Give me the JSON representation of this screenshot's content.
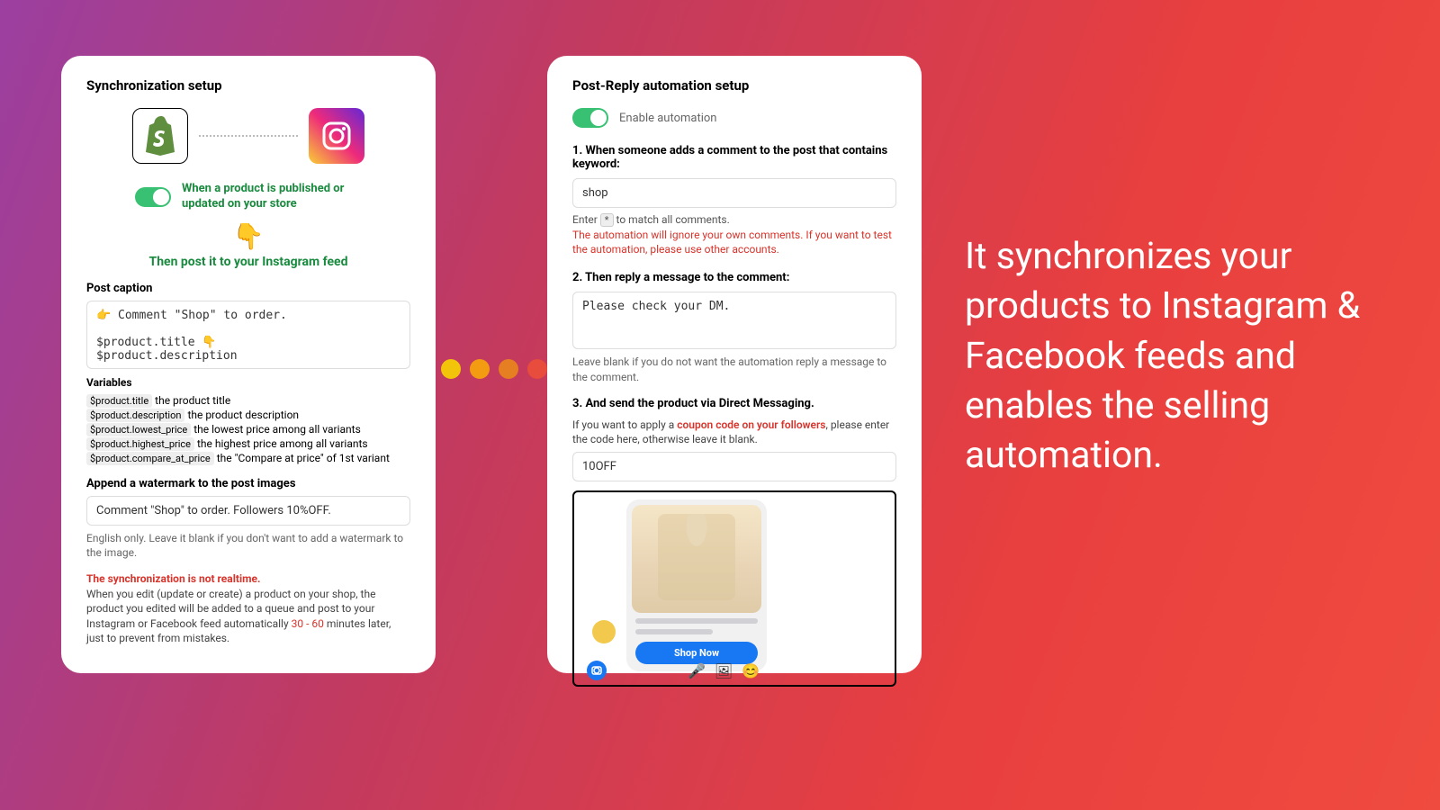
{
  "headline": "It synchronizes your products to Instagram & Facebook feeds and enables the selling automation.",
  "left": {
    "title": "Synchronization setup",
    "sync_toggle": "When a product is published or updated on your store",
    "then_post": "Then post it to your Instagram feed",
    "caption_label": "Post caption",
    "caption_value": "👉 Comment \"Shop\" to order.\n\n$product.title 👇\n$product.description",
    "variables_label": "Variables",
    "vars": [
      {
        "code": "$product.title",
        "desc": "the product title"
      },
      {
        "code": "$product.description",
        "desc": "the product description"
      },
      {
        "code": "$product.lowest_price",
        "desc": "the lowest price among all variants"
      },
      {
        "code": "$product.highest_price",
        "desc": "the highest price among all variants"
      },
      {
        "code": "$product.compare_at_price",
        "desc": "the \"Compare at price\" of 1st variant"
      }
    ],
    "watermark_label": "Append a watermark to the post images",
    "watermark_value": "Comment \"Shop\" to order. Followers 10%OFF.",
    "watermark_help": "English only. Leave it blank if you don't want to add a watermark to the image.",
    "warn_title": "The synchronization is not realtime.",
    "warn_body_pre": "When you edit (update or create) a product on your shop, the product you edited will be added to a queue and post to your Instagram or Facebook feed automatically ",
    "warn_body_red": "30 - 60",
    "warn_body_post": " minutes later, just to prevent from mistakes."
  },
  "right": {
    "title": "Post-Reply automation setup",
    "enable_label": "Enable automation",
    "step1": "1. When someone adds a comment to the post that contains keyword:",
    "keyword_value": "shop",
    "match_pre": "Enter ",
    "match_key": "*",
    "match_post": " to match all comments.",
    "ignore_warn": "The automation will ignore your own comments. If you want to test the automation, please use other accounts.",
    "step2": "2. Then reply a message to the comment:",
    "reply_value": "Please check your DM.",
    "reply_help": "Leave blank if you do not want the automation reply a message to the comment.",
    "step3": "3. And send the product  via Direct Messaging.",
    "coupon_pre": "If you want to apply a ",
    "coupon_red": "coupon code on your followers",
    "coupon_post": ", please enter the code here, otherwise leave it blank.",
    "coupon_value": "10OFF",
    "shop_now": "Shop Now"
  }
}
